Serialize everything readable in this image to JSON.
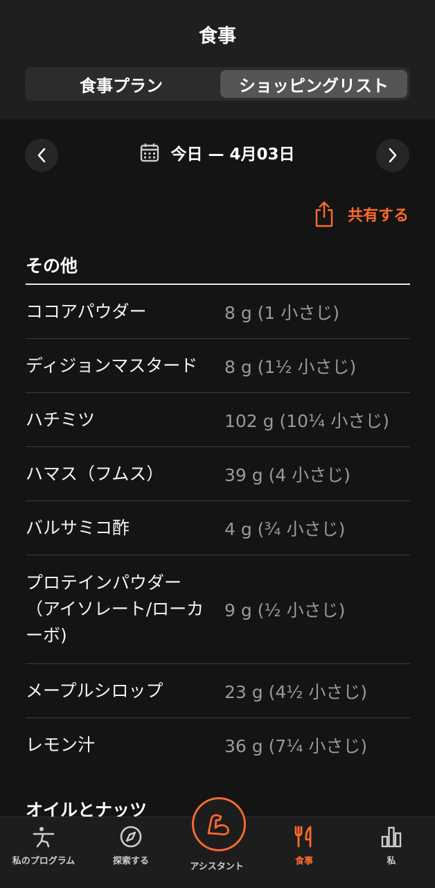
{
  "header": {
    "title": "食事"
  },
  "segments": {
    "plan": "食事プラン",
    "shopping": "ショッピングリスト"
  },
  "date": {
    "label": "今日 — 4月03日"
  },
  "share": {
    "label": "共有する"
  },
  "sections": [
    {
      "title": "その他",
      "items": [
        {
          "name": "ココアパウダー",
          "amount": "8 g (1 小さじ)"
        },
        {
          "name": "ディジョンマスタード",
          "amount": "8 g (1½ 小さじ)"
        },
        {
          "name": "ハチミツ",
          "amount": "102 g (10¼ 小さじ)"
        },
        {
          "name": "ハマス（フムス）",
          "amount": "39 g (4 小さじ)"
        },
        {
          "name": "バルサミコ酢",
          "amount": "4 g (¾ 小さじ)"
        },
        {
          "name": "プロテインパウダー（アイソレート/ローカーボ)",
          "amount": "9 g (½ 小さじ)"
        },
        {
          "name": "メープルシロップ",
          "amount": "23 g (4½ 小さじ)"
        },
        {
          "name": "レモン汁",
          "amount": "36 g (7¼ 小さじ)"
        }
      ]
    },
    {
      "title": "オイルとナッツ"
    }
  ],
  "tabs": {
    "program": "私のプログラム",
    "explore": "探索する",
    "assistant": "アシスタント",
    "meals": "食事",
    "me": "私"
  },
  "colors": {
    "accent": "#ff6a2e",
    "background": "#141414"
  }
}
